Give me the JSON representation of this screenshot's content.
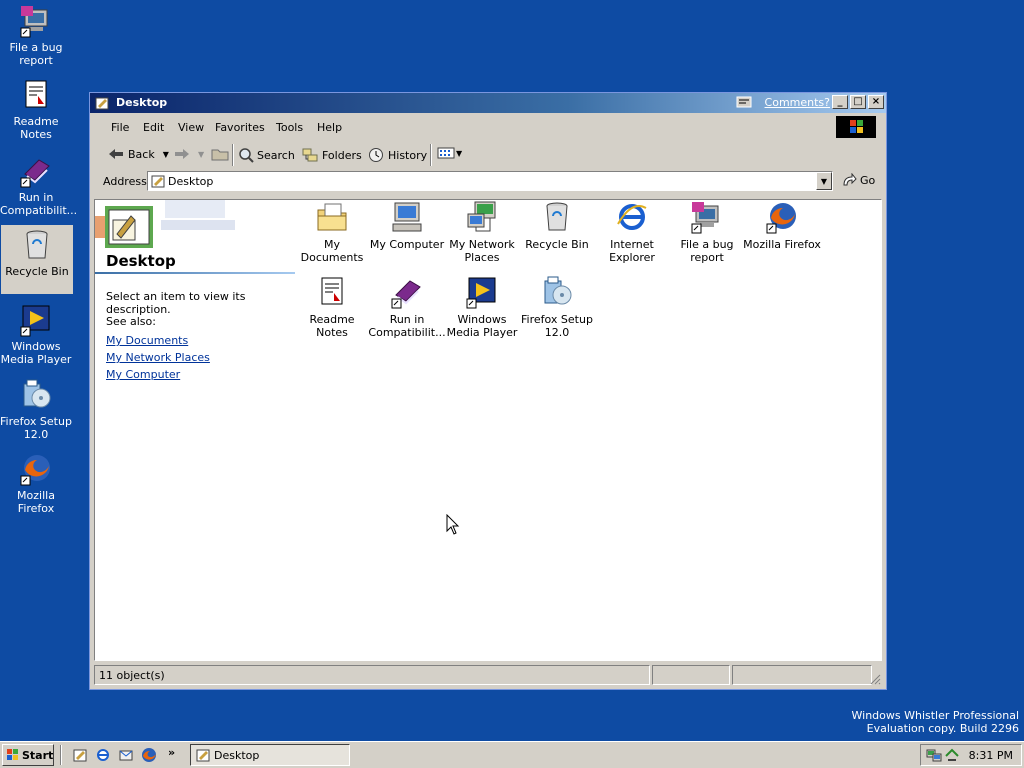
{
  "desktop": {
    "icons": [
      {
        "label": "File a bug report"
      },
      {
        "label": "Readme Notes"
      },
      {
        "label": "Run in Compatibilit..."
      },
      {
        "label": "Recycle Bin"
      },
      {
        "label": "Windows Media Player"
      },
      {
        "label": "Firefox Setup 12.0"
      },
      {
        "label": "Mozilla Firefox"
      }
    ],
    "watermark_line1": "Windows Whistler Professional",
    "watermark_line2": "Evaluation copy. Build 2296"
  },
  "window": {
    "title": "Desktop",
    "comments_link": "Comments?",
    "menu": [
      "File",
      "Edit",
      "View",
      "Favorites",
      "Tools",
      "Help"
    ],
    "toolbar": {
      "back": "Back",
      "search": "Search",
      "folders": "Folders",
      "history": "History"
    },
    "address": {
      "label": "Address",
      "value": "Desktop",
      "go": "Go"
    },
    "panel": {
      "heading": "Desktop",
      "description": "Select an item to view its description.",
      "see_also": "See also:",
      "links": [
        "My Documents",
        "My Network Places",
        "My Computer"
      ]
    },
    "items": [
      {
        "label": "My Documents"
      },
      {
        "label": "My Computer"
      },
      {
        "label": "My Network Places"
      },
      {
        "label": "Recycle Bin"
      },
      {
        "label": "Internet Explorer"
      },
      {
        "label": "File a bug report"
      },
      {
        "label": "Mozilla Firefox"
      },
      {
        "label": "Readme Notes"
      },
      {
        "label": "Run in Compatibilit..."
      },
      {
        "label": "Windows Media Player"
      },
      {
        "label": "Firefox Setup 12.0"
      }
    ],
    "status": "11 object(s)"
  },
  "taskbar": {
    "start": "Start",
    "more": "»",
    "task_label": "Desktop",
    "clock": "8:31 PM"
  }
}
